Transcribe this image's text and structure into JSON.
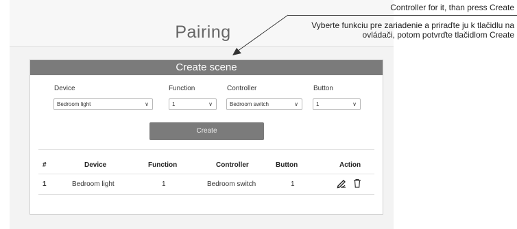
{
  "page": {
    "title": "Pairing"
  },
  "annotation": {
    "line1": "Controller for it, than press Create",
    "line2": "Vyberte funkciu pre zariadenie a priraďte ju k tlačidlu na ovládači, potom potvrďte tlačidlom Create"
  },
  "scene": {
    "title": "Create scene",
    "fields": {
      "device": {
        "label": "Device",
        "value": "Bedroom light"
      },
      "function": {
        "label": "Function",
        "value": "1"
      },
      "controller": {
        "label": "Controller",
        "value": "Bedroom switch"
      },
      "button": {
        "label": "Button",
        "value": "1"
      }
    },
    "create_label": "Create",
    "table": {
      "headers": [
        "#",
        "Device",
        "Function",
        "Controller",
        "Button",
        "Action"
      ],
      "rows": [
        {
          "index": "1",
          "device": "Bedroom light",
          "function": "1",
          "controller": "Bedroom switch",
          "button": "1"
        }
      ]
    }
  },
  "icons": [
    "chevron-down-icon",
    "edit-icon",
    "trash-icon",
    "arrow-icon"
  ],
  "colors": {
    "header": "#7b7b7b",
    "button": "#7b7b7b",
    "background": "#f3f3f3"
  }
}
